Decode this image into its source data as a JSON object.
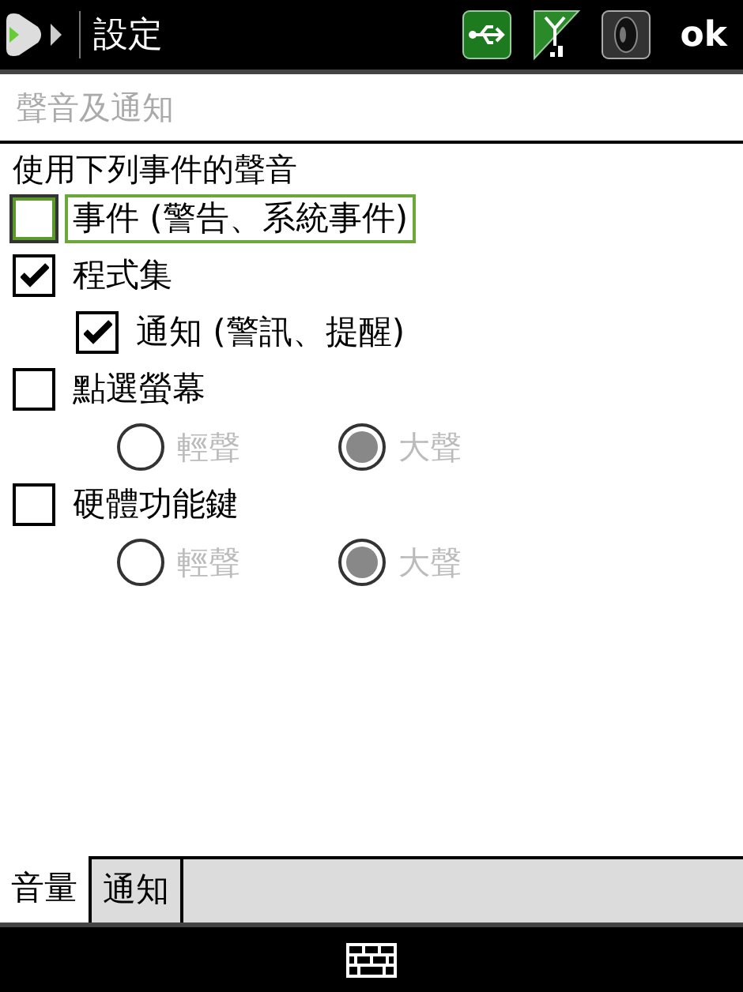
{
  "title_bar": {
    "title": "設定",
    "ok": "ok"
  },
  "page_header": "聲音及通知",
  "section_label": "使用下列事件的聲音",
  "options": [
    {
      "label": "事件 (警告、系統事件)",
      "checked": false,
      "focused": true
    },
    {
      "label": "程式集",
      "checked": true,
      "focused": false,
      "children": [
        {
          "label": "通知 (警訊、提醒)",
          "checked": true,
          "focused": false
        }
      ]
    },
    {
      "label": "點選螢幕",
      "checked": false,
      "focused": false,
      "radios": [
        {
          "label": "輕聲",
          "selected": false,
          "disabled": true
        },
        {
          "label": "大聲",
          "selected": true,
          "disabled": true
        }
      ]
    },
    {
      "label": "硬體功能鍵",
      "checked": false,
      "focused": false,
      "radios": [
        {
          "label": "輕聲",
          "selected": false,
          "disabled": true
        },
        {
          "label": "大聲",
          "selected": true,
          "disabled": true
        }
      ]
    }
  ],
  "tabs": [
    {
      "label": "音量",
      "selected": true
    },
    {
      "label": "通知",
      "selected": false
    }
  ]
}
